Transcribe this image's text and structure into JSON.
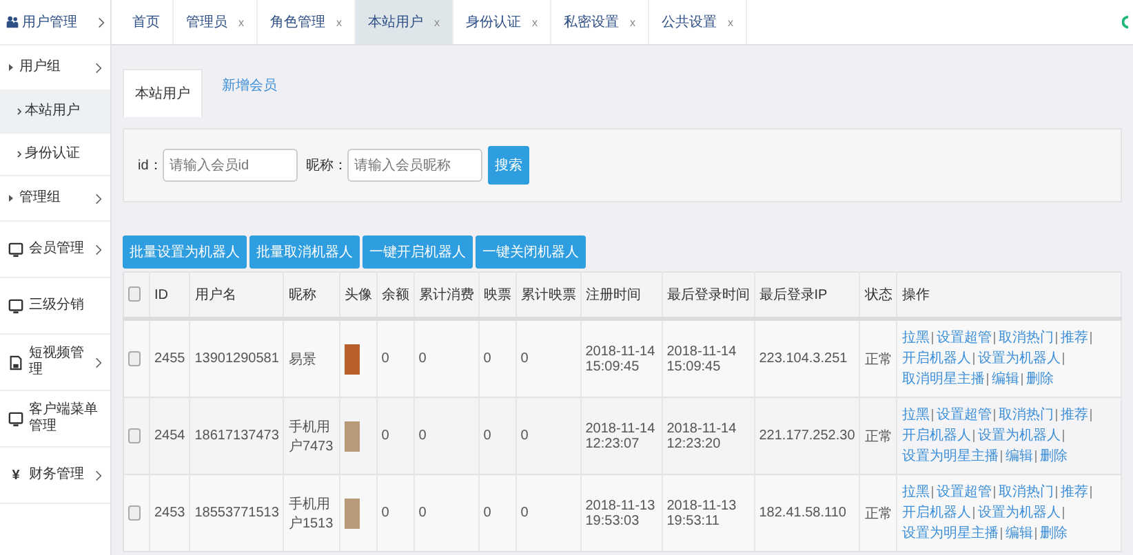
{
  "sidebar": {
    "header": {
      "label": "用户管理"
    },
    "items": [
      {
        "kind": "group",
        "label": "用户组",
        "expandable": true,
        "selected": false
      },
      {
        "kind": "sub",
        "label": "本站用户",
        "expandable": false,
        "selected": true
      },
      {
        "kind": "sub",
        "label": "身份认证",
        "expandable": false,
        "selected": false
      },
      {
        "kind": "group",
        "label": "管理组",
        "expandable": true,
        "selected": false
      },
      {
        "kind": "menu",
        "label": "会员管理",
        "expandable": true,
        "selected": false
      },
      {
        "kind": "menu",
        "label": "三级分销",
        "expandable": false,
        "selected": false
      },
      {
        "kind": "doc-menu",
        "label": "短视频管理",
        "expandable": true,
        "selected": false
      },
      {
        "kind": "menu",
        "label": "客户端菜单管理",
        "expandable": false,
        "selected": false
      },
      {
        "kind": "glyph-menu",
        "glyph": "¥",
        "label": "财务管理",
        "expandable": true,
        "selected": false
      }
    ]
  },
  "tabs": [
    {
      "label": "首页",
      "selected": false
    },
    {
      "label": "管理员",
      "close": "x",
      "selected": false
    },
    {
      "label": "角色管理",
      "close": "x",
      "selected": false
    },
    {
      "label": "本站用户",
      "close": "x",
      "selected": true
    },
    {
      "label": "身份认证",
      "close": "x",
      "selected": false
    },
    {
      "label": "私密设置",
      "close": "x",
      "selected": false
    },
    {
      "label": "公共设置",
      "close": "x",
      "selected": false
    }
  ],
  "subtabs": [
    {
      "label": "本站用户",
      "selected": true
    },
    {
      "label": "新增会员",
      "selected": false
    }
  ],
  "search": {
    "fields": [
      {
        "label": "id：",
        "placeholder": "请输入会员id"
      },
      {
        "label": "昵称：",
        "placeholder": "请输入会员昵称"
      }
    ],
    "button": "搜索"
  },
  "bulk_buttons": [
    "批量设置为机器人",
    "批量取消机器人",
    "一键开启机器人",
    "一键关闭机器人"
  ],
  "table": {
    "header_checked": false,
    "columns": [
      "ID",
      "用户名",
      "昵称",
      "头像",
      "余额",
      "累计消费",
      "映票",
      "累计映票",
      "注册时间",
      "最后登录时间",
      "最后登录IP",
      "状态",
      "操作"
    ],
    "rows": [
      {
        "checked": false,
        "id": "2455",
        "username": "13901290581",
        "nickname": "易景",
        "balance": "0",
        "consumption": "0",
        "tickets": "0",
        "total_tickets": "0",
        "reg_time": "2018-11-14 15:09:45",
        "last_login": "2018-11-14 15:09:45",
        "ip": "223.104.3.251",
        "status": "正常",
        "actions": [
          "拉黑",
          "设置超管",
          "取消热门",
          "推荐",
          "开启机器人",
          "设置为机器人",
          "取消明星主播",
          "编辑",
          "删除"
        ]
      },
      {
        "checked": false,
        "id": "2454",
        "username": "18617137473",
        "nickname": "手机用户7473",
        "balance": "0",
        "consumption": "0",
        "tickets": "0",
        "total_tickets": "0",
        "reg_time": "2018-11-14 12:23:07",
        "last_login": "2018-11-14 12:23:20",
        "ip": "221.177.252.30",
        "status": "正常",
        "actions": [
          "拉黑",
          "设置超管",
          "取消热门",
          "推荐",
          "开启机器人",
          "设置为机器人",
          "设置为明星主播",
          "编辑",
          "删除"
        ]
      },
      {
        "checked": false,
        "id": "2453",
        "username": "18553771513",
        "nickname": "手机用户1513",
        "balance": "0",
        "consumption": "0",
        "tickets": "0",
        "total_tickets": "0",
        "reg_time": "2018-11-13 19:53:03",
        "last_login": "2018-11-13 19:53:11",
        "ip": "182.41.58.110",
        "status": "正常",
        "actions": [
          "拉黑",
          "设置超管",
          "取消热门",
          "推荐",
          "开启机器人",
          "设置为机器人",
          "设置为明星主播",
          "编辑",
          "删除"
        ]
      }
    ]
  }
}
